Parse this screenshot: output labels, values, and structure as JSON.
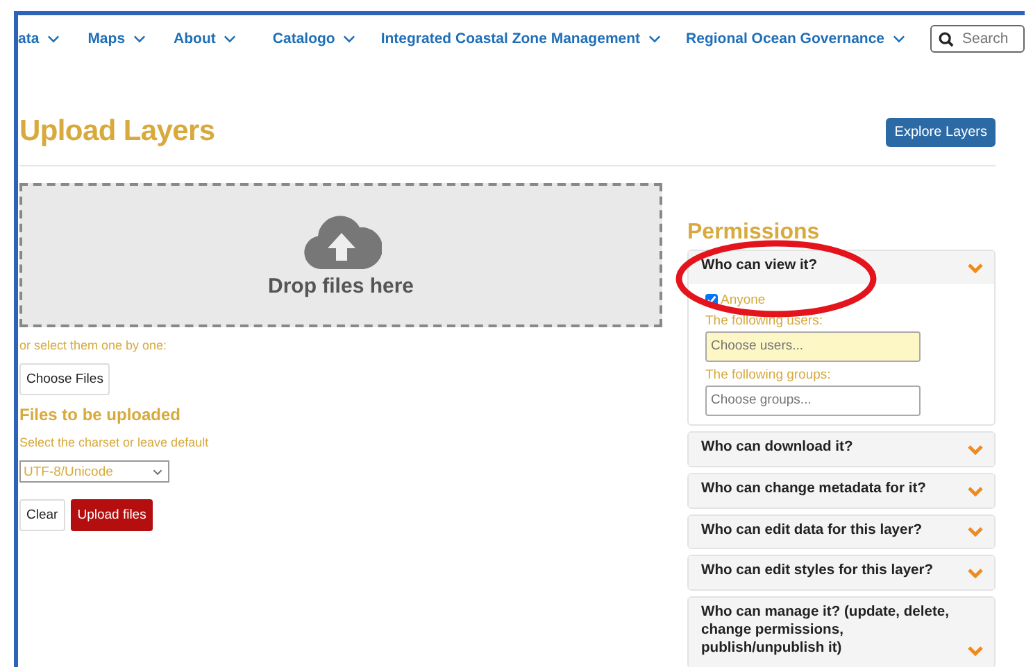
{
  "nav": {
    "items": [
      {
        "label": "ata"
      },
      {
        "label": "Maps"
      },
      {
        "label": "About"
      },
      {
        "label": "Catalogo"
      },
      {
        "label": "Integrated Coastal Zone Management"
      },
      {
        "label": "Regional Ocean Governance"
      }
    ],
    "search": {
      "placeholder": "Search"
    }
  },
  "page": {
    "title": "Upload Layers",
    "explore_button": "Explore Layers"
  },
  "upload": {
    "drop_text": "Drop files here",
    "select_hint": "or select them one by one:",
    "choose_button": "Choose Files",
    "files_heading": "Files to be uploaded",
    "charset_hint": "Select the charset or leave default",
    "charset_value": "UTF-8/Unicode",
    "clear_button": "Clear",
    "upload_button": "Upload files"
  },
  "permissions": {
    "title": "Permissions",
    "sections": [
      {
        "title": "Who can view it?",
        "expanded": true,
        "anyone_label": "Anyone",
        "anyone_checked": true,
        "users_label": "The following users:",
        "users_placeholder": "Choose users...",
        "groups_label": "The following groups:",
        "groups_placeholder": "Choose groups..."
      },
      {
        "title": "Who can download it?",
        "expanded": false
      },
      {
        "title": "Who can change metadata for it?",
        "expanded": false
      },
      {
        "title": "Who can edit data for this layer?",
        "expanded": false
      },
      {
        "title": "Who can edit styles for this layer?",
        "expanded": false
      },
      {
        "title": "Who can manage it? (update, delete, change permissions, publish/unpublish it)",
        "expanded": false
      }
    ]
  },
  "annotation": {
    "kind": "ellipse"
  }
}
